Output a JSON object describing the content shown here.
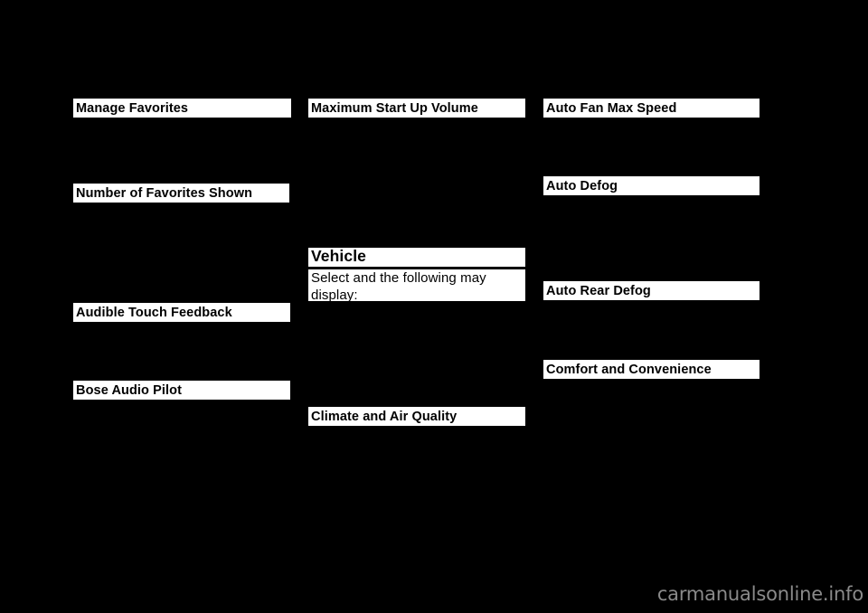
{
  "page": {
    "background_color": "#000000",
    "text_highlight_color": "#ffffff",
    "text_color": "#000000"
  },
  "columns": [
    {
      "id": "column-1",
      "blocks": [
        {
          "id": "manage-favorites",
          "kind": "heading",
          "text": "Manage Favorites"
        },
        {
          "id": "number-of-favorites-shown",
          "kind": "heading",
          "text": "Number of Favorites Shown"
        },
        {
          "id": "audible-touch-feedback",
          "kind": "heading",
          "text": "Audible Touch Feedback"
        },
        {
          "id": "bose-audio-pilot",
          "kind": "heading",
          "text": "Bose Audio Pilot"
        }
      ]
    },
    {
      "id": "column-2",
      "blocks": [
        {
          "id": "maximum-start-up-volume",
          "kind": "heading",
          "text": "Maximum Start Up Volume"
        },
        {
          "id": "vehicle",
          "kind": "section-heading",
          "text": "Vehicle"
        },
        {
          "id": "vehicle-body",
          "kind": "body",
          "text": "Select and the following may display:"
        },
        {
          "id": "climate-and-air-quality",
          "kind": "heading",
          "text": "Climate and Air Quality"
        }
      ]
    },
    {
      "id": "column-3",
      "blocks": [
        {
          "id": "auto-fan-max-speed",
          "kind": "heading",
          "text": "Auto Fan Max Speed"
        },
        {
          "id": "auto-defog",
          "kind": "heading",
          "text": "Auto Defog"
        },
        {
          "id": "auto-rear-defog",
          "kind": "heading",
          "text": "Auto Rear Defog"
        },
        {
          "id": "comfort-and-convenience",
          "kind": "heading",
          "text": "Comfort and Convenience"
        }
      ]
    }
  ],
  "watermark": {
    "text": "carmanualsonline.info",
    "color": "#8a8a8a"
  }
}
